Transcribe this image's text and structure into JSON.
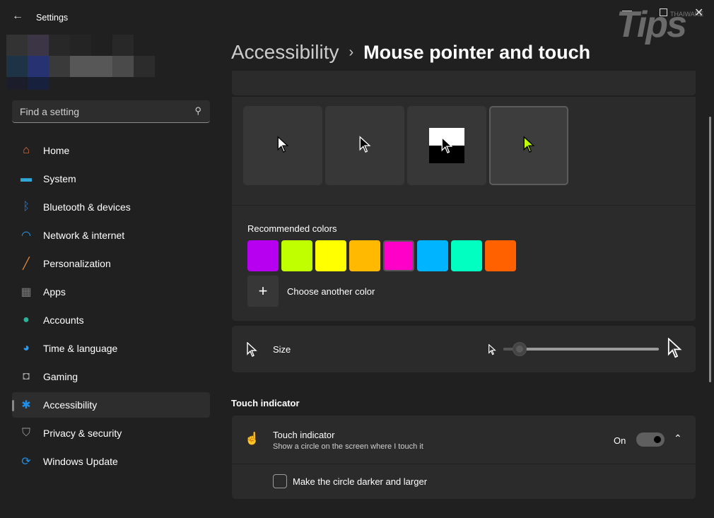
{
  "window": {
    "title": "Settings",
    "controls": [
      "minimize",
      "maximize",
      "close"
    ]
  },
  "watermark": {
    "logo_text": "Tips",
    "brand": "THAIWARE"
  },
  "search": {
    "placeholder": "Find a setting"
  },
  "sidebar": {
    "items": [
      {
        "label": "Home",
        "icon": "home-icon",
        "color": "#e8743b"
      },
      {
        "label": "System",
        "icon": "monitor-icon",
        "color": "#2fa7d8"
      },
      {
        "label": "Bluetooth & devices",
        "icon": "bluetooth-icon",
        "color": "#1f7fe0"
      },
      {
        "label": "Network & internet",
        "icon": "wifi-icon",
        "color": "#2a9cf0"
      },
      {
        "label": "Personalization",
        "icon": "brush-icon",
        "color": "#e88a3b"
      },
      {
        "label": "Apps",
        "icon": "apps-icon",
        "color": "#7a7a7a"
      },
      {
        "label": "Accounts",
        "icon": "person-icon",
        "color": "#2bb39a"
      },
      {
        "label": "Time & language",
        "icon": "globe-clock-icon",
        "color": "#2a9cf0"
      },
      {
        "label": "Gaming",
        "icon": "gamepad-icon",
        "color": "#9a9a9a"
      },
      {
        "label": "Accessibility",
        "icon": "accessibility-icon",
        "color": "#1f8fe8",
        "selected": true
      },
      {
        "label": "Privacy & security",
        "icon": "shield-icon",
        "color": "#9a9a9a"
      },
      {
        "label": "Windows Update",
        "icon": "update-icon",
        "color": "#1f8fe8"
      }
    ]
  },
  "breadcrumb": {
    "parent": "Accessibility",
    "current": "Mouse pointer and touch"
  },
  "pointer_styles": {
    "options": [
      "white",
      "black",
      "inverted",
      "custom"
    ],
    "selected": "custom"
  },
  "colors": {
    "label": "Recommended colors",
    "swatches": [
      "#b800f0",
      "#bfff00",
      "#ffff00",
      "#ffb900",
      "#ff00c8",
      "#00b4ff",
      "#00ffc0",
      "#ff6000"
    ],
    "selected": "#ff00c8",
    "choose_label": "Choose another color",
    "current_pointer_color": "#bfff00"
  },
  "size": {
    "label": "Size",
    "value_fraction": 0.1
  },
  "touch": {
    "section": "Touch indicator",
    "title": "Touch indicator",
    "subtitle": "Show a circle on the screen where I touch it",
    "state": "On",
    "toggle_on": true,
    "checkbox_label": "Make the circle darker and larger",
    "checkbox_checked": false
  }
}
